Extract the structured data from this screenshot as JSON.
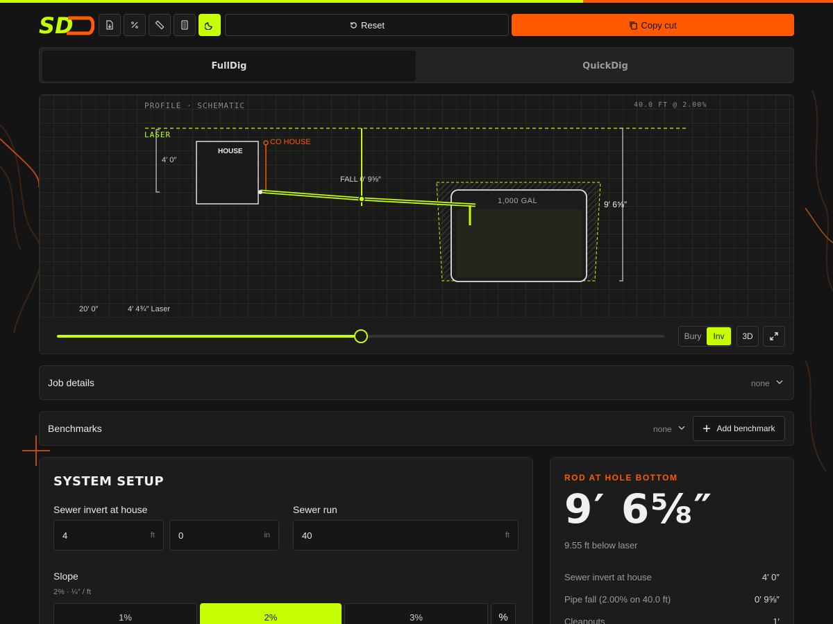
{
  "app": {
    "logo_text": "SD"
  },
  "colors": {
    "accent": "#c6ff00",
    "brand": "#ff5a00",
    "background": "#141414"
  },
  "progress": {
    "fraction": 0.7
  },
  "toolbar": {
    "icons": [
      "file-export-icon",
      "percent-icon",
      "ruler-icon",
      "calculator-icon",
      "moon-icon"
    ],
    "reset_label": "Reset",
    "copy_label": "Copy cut"
  },
  "modes": {
    "active": "FullDig",
    "inactive": "QuickDig"
  },
  "schematic": {
    "title": "PROFILE · SCHEMATIC",
    "summary": "40.0 FT @ 2.00%",
    "laser_label": "LASER",
    "house_label": "HOUSE",
    "co_label": "CO HOUSE",
    "house_depth": "4′ 0″",
    "fall_label": "FALL 0′ 9⅝″",
    "tank_label": "1,000 GAL",
    "tank_depth": "9′ 6⅝″",
    "run_label": "20′ 0″",
    "laser_reading": "4′ 4¾″ Laser",
    "slider_fraction": 0.5
  },
  "view_controls": {
    "bury": "Bury",
    "inv": "Inv",
    "three_d": "3D"
  },
  "job_details": {
    "title": "Job details",
    "meta": "none"
  },
  "benchmarks": {
    "title": "Benchmarks",
    "meta": "none",
    "add_label": "Add benchmark"
  },
  "setup": {
    "title": "SYSTEM SETUP",
    "invert_label": "Sewer invert at house",
    "invert_ft": "4",
    "invert_ft_unit": "ft",
    "invert_in": "0",
    "invert_in_unit": "in",
    "run_label": "Sewer run",
    "run_value": "40",
    "run_unit": "ft",
    "slope_label": "Slope",
    "slope_sub": "2% · ¼″ / ft",
    "slope_options": [
      "1%",
      "2%",
      "3%"
    ],
    "slope_selected": "2%",
    "slope_custom": "%"
  },
  "result": {
    "kicker": "ROD AT HOLE BOTTOM",
    "value": "9′ 6⅝″",
    "below": "9.55 ft below laser",
    "rows": [
      {
        "label": "Sewer invert at house",
        "value": "4′ 0″"
      },
      {
        "label": "Pipe fall (2.00% on 40.0 ft)",
        "value": "0′ 9⅝″"
      },
      {
        "label": "Cleanouts",
        "value": "1′"
      }
    ]
  }
}
